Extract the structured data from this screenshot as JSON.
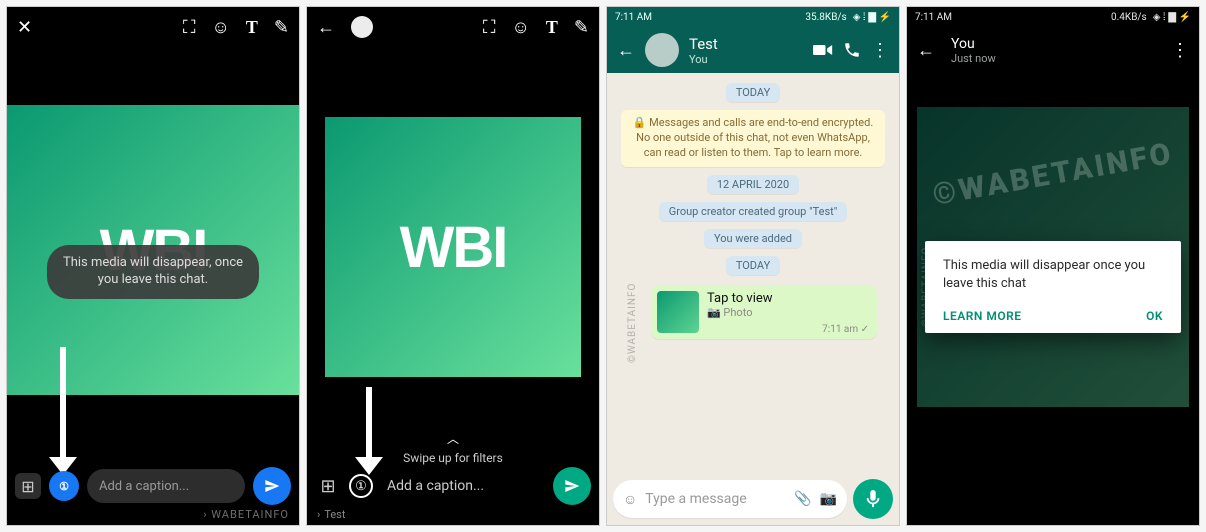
{
  "panel1": {
    "tooltip": "This media will disappear, once you leave this chat.",
    "caption_placeholder": "Add a caption...",
    "watermark": "WABETAINFO",
    "wbi": "WBI"
  },
  "panel2": {
    "swipe_hint": "Swipe up for filters",
    "caption_placeholder": "Add a caption...",
    "recipient": "Test",
    "wbi": "WBI"
  },
  "panel3": {
    "status_time": "7:11 AM",
    "status_speed": "35.8KB/s",
    "chat_title": "Test",
    "chat_sub": "You",
    "chip_today1": "TODAY",
    "encryption": "🔒 Messages and calls are end-to-end encrypted. No one outside of this chat, not even WhatsApp, can read or listen to them. Tap to learn more.",
    "chip_date": "12 APRIL 2020",
    "chip_created": "Group creator created group \"Test\"",
    "chip_added": "You were added",
    "chip_today2": "TODAY",
    "bubble_label": "Tap to view",
    "bubble_sub": "📷 Photo",
    "bubble_time": "7:11 am ✓",
    "input_placeholder": "Type a message",
    "watermark": "©WABETAINFO"
  },
  "panel4": {
    "status_time": "7:11 AM",
    "status_speed": "0.4KB/s",
    "header_title": "You",
    "header_sub": "Just now",
    "watermark": "©WABETAINFO",
    "dialog_text": "This media will disappear once you leave this chat",
    "learn_more": "LEARN MORE",
    "ok": "OK"
  }
}
